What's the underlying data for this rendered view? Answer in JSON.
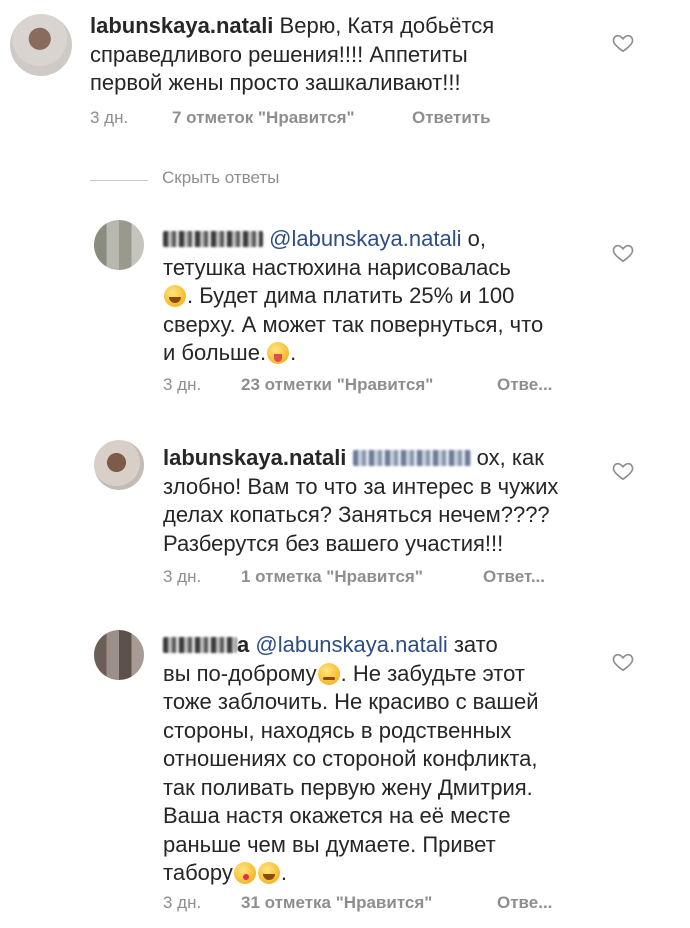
{
  "comments": [
    {
      "username": "labunskaya.natali",
      "lines": [
        "Верю, Катя добьётся",
        "справедливого решения!!!! Аппетиты",
        "первой жены просто зашкаливают!!!"
      ],
      "age": "3 дн.",
      "likes": "7 отметок \"Нравится\"",
      "reply": "Ответить"
    },
    {
      "username_tail": "",
      "mention": "@labunskaya.natali",
      "lines": [
        "о,",
        "тетушка настюхина нарисовалась",
        ". Будет дима платить 25% и 100",
        "сверху. А может так повернуться, что",
        "и больше."
      ],
      "age": "3 дн.",
      "likes": "23 отметки \"Нравится\"",
      "reply": "Отве..."
    },
    {
      "username": "labunskaya.natali",
      "lines": [
        "ох, как",
        "злобно! Вам то что за интерес в чужих",
        "делах копаться? Заняться нечем????",
        "Разберутся без вашего участия!!!"
      ],
      "age": "3 дн.",
      "likes": "1 отметка \"Нравится\"",
      "reply": "Ответ..."
    },
    {
      "username_tail": "a",
      "mention": "@labunskaya.natali",
      "lines": [
        "зато",
        "вы по-доброму",
        ". Не забудьте этот",
        "тоже заблочить. Не красиво с вашей",
        "стороны, находясь в родственных",
        "отношениях со стороной конфликта,",
        "так поливать первую жену Дмитрия.",
        "Ваша настя окажется на её месте",
        "раньше чем вы думаете. Привет",
        "табору",
        "."
      ],
      "age": "3 дн.",
      "likes": "31 отметка \"Нравится\"",
      "reply": "Отве..."
    }
  ],
  "hide_replies": "Скрыть ответы",
  "icons": {
    "like": "heart-outline-icon",
    "emoji": "smiley-emoji-icon"
  },
  "colors": {
    "text": "#262626",
    "meta": "#8e8e8e",
    "mention": "#2d4d86"
  }
}
